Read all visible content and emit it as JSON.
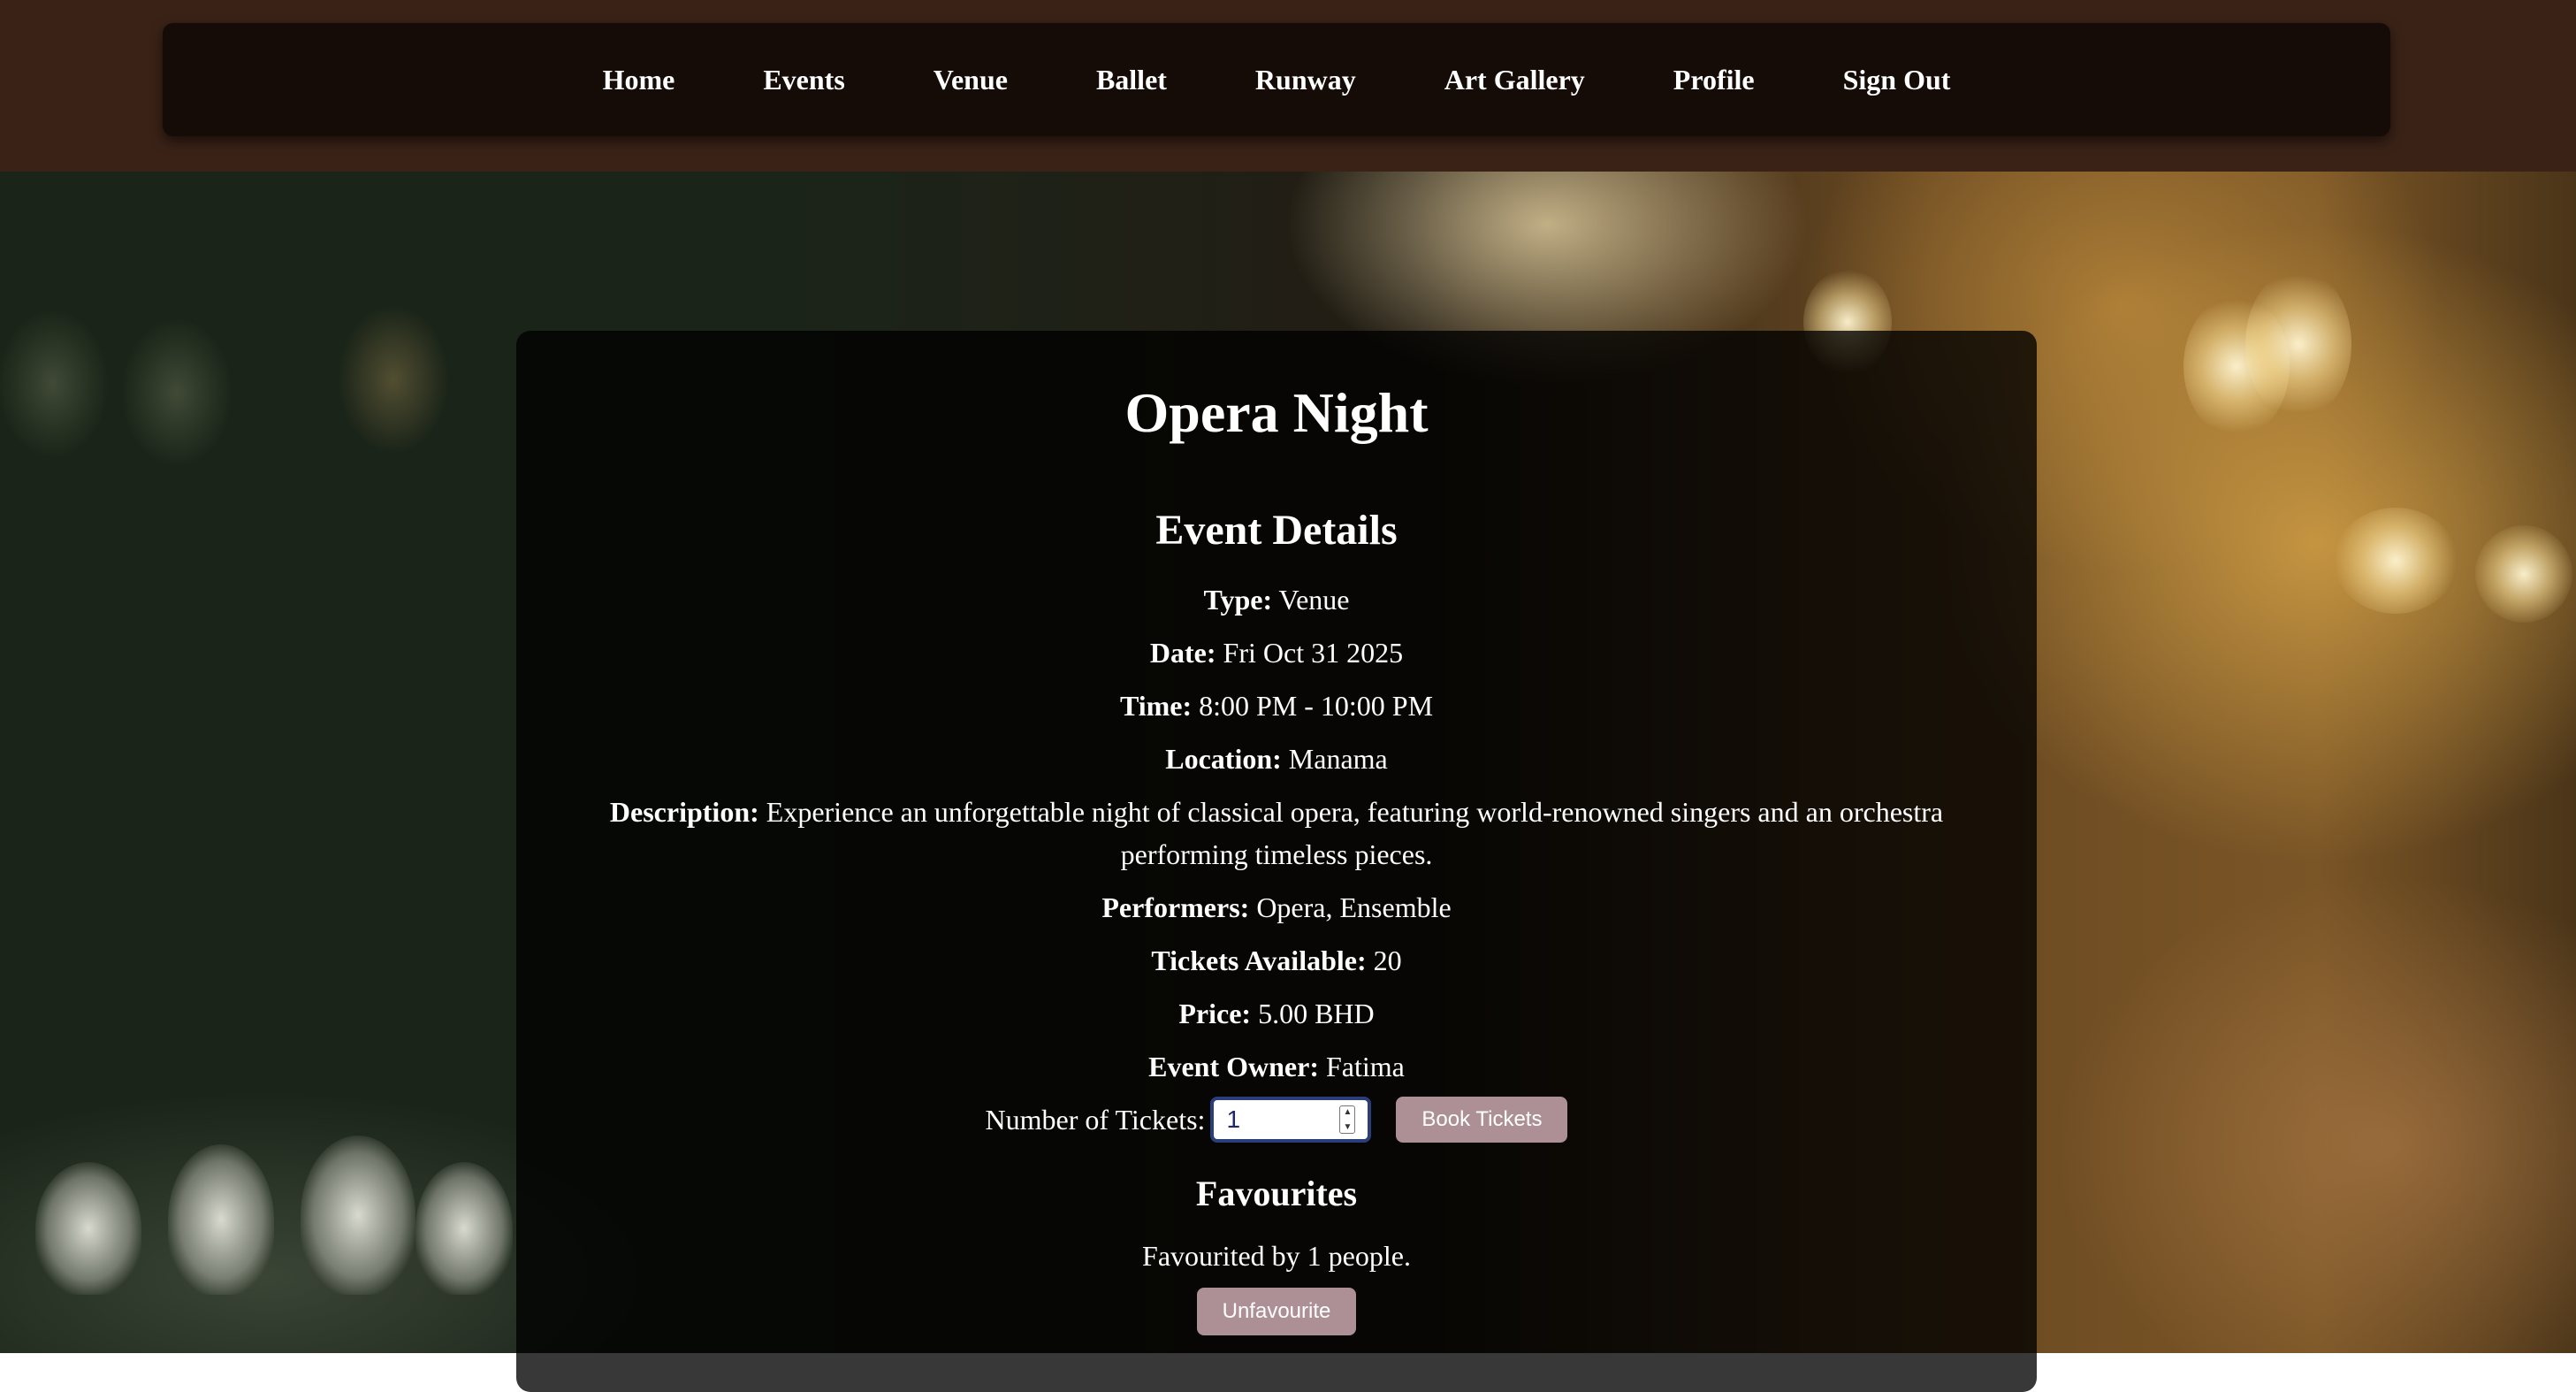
{
  "nav": {
    "items": [
      "Home",
      "Events",
      "Venue",
      "Ballet",
      "Runway",
      "Art Gallery",
      "Profile",
      "Sign Out"
    ]
  },
  "event": {
    "title": "Opera Night",
    "section_title": "Event Details",
    "details": {
      "type": {
        "label": "Type:",
        "value": "Venue"
      },
      "date": {
        "label": "Date:",
        "value": "Fri Oct 31 2025"
      },
      "time": {
        "label": "Time:",
        "value": "8:00 PM - 10:00 PM"
      },
      "location": {
        "label": "Location:",
        "value": "Manama"
      },
      "description": {
        "label": "Description:",
        "value": "Experience an unforgettable night of classical opera, featuring world-renowned singers and an orchestra performing timeless pieces."
      },
      "performers": {
        "label": "Performers:",
        "value": "Opera, Ensemble"
      },
      "tickets_available": {
        "label": "Tickets Available:",
        "value": "20"
      },
      "price": {
        "label": "Price:",
        "value": "5.00 BHD"
      },
      "owner": {
        "label": "Event Owner:",
        "value": "Fatima"
      }
    }
  },
  "booking": {
    "label": "Number of Tickets:",
    "quantity": "1",
    "book_label": "Book Tickets"
  },
  "favourites": {
    "title": "Favourites",
    "text": "Favourited by 1 people.",
    "button_label": "Unfavourite"
  },
  "colors": {
    "topbar": "#3a2217",
    "navbar": "#150c08",
    "button": "#ad9096",
    "input_focus": "#2a3f7a"
  }
}
